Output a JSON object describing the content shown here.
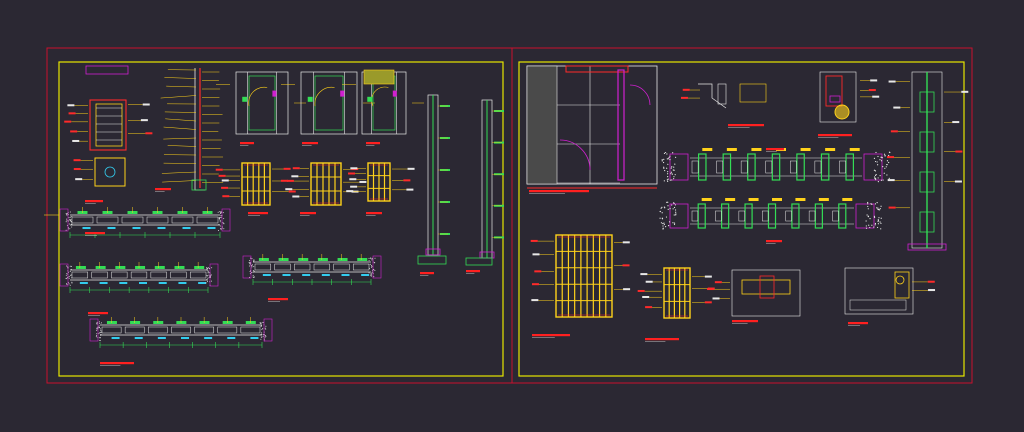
{
  "colors": {
    "background": "#2b2833",
    "sheet_border": "#c8102e",
    "frame_border": "#e6e600",
    "line_yellow": "#ffd21a",
    "line_red": "#ff2a2a",
    "line_green": "#33dd55",
    "line_white": "#e8e8e8",
    "line_magenta": "#d020d0",
    "line_cyan": "#33ccee",
    "fill_gray": "#7a7a7a",
    "fill_olive": "#9a9a2a",
    "label_red": "#ff2020"
  },
  "sheets": [
    {
      "name": "sheet-left",
      "details": [
        "plan-detail-a",
        "wall-section-a",
        "door-elevation-a",
        "door-elevation-b",
        "door-elevation-c",
        "door-leaf-a",
        "door-leaf-b",
        "door-leaf-c",
        "frame-section-a",
        "frame-section-b",
        "threshold-section",
        "partition-section-a",
        "partition-section-b",
        "partition-section-c"
      ]
    },
    {
      "name": "sheet-right",
      "details": [
        "floor-plan-detail",
        "head-detail",
        "jamb-detail-a",
        "jamb-detail-b",
        "wall-section-b",
        "partition-section-d",
        "partition-section-e",
        "door-leaf-large",
        "door-leaf-small",
        "hinge-detail-a",
        "hinge-detail-b"
      ]
    }
  ]
}
